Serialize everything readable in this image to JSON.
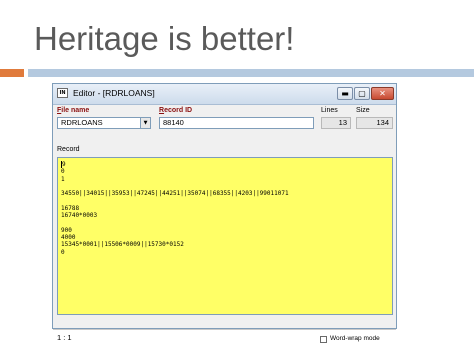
{
  "slide": {
    "title": "Heritage is better!"
  },
  "window": {
    "icon_text": "IN",
    "title": "Editor - [RDRLOANS]",
    "btn_min": "▬",
    "btn_max": "▢",
    "btn_close": "✕"
  },
  "fields": {
    "file_name_label_u": "F",
    "file_name_label_rest": "ile name",
    "file_name_value": "RDRLOANS",
    "record_id_label_u": "R",
    "record_id_label_rest": "ecord ID",
    "record_id_value": "88140",
    "lines_label": "Lines",
    "lines_value": "13",
    "size_label": "Size",
    "size_value": "134",
    "record_label": "Record"
  },
  "record_lines": [
    "9",
    "0",
    "1",
    "",
    "34550||34015||35953||47245||44251||35074||68355||4203||99011071",
    "",
    "16788",
    "16740*0003",
    "",
    "900",
    "4000",
    "15345*0001||15506*0009||15730*0152",
    "0"
  ],
  "status": {
    "position": "1 : 1",
    "word_wrap_label": "Word-wrap mode",
    "word_wrap_checked": false
  },
  "colors": {
    "record_bg": "#ffff66",
    "accent_orange": "#e07b3c",
    "accent_blue": "#b4c9df",
    "label_red": "#8b1010"
  }
}
